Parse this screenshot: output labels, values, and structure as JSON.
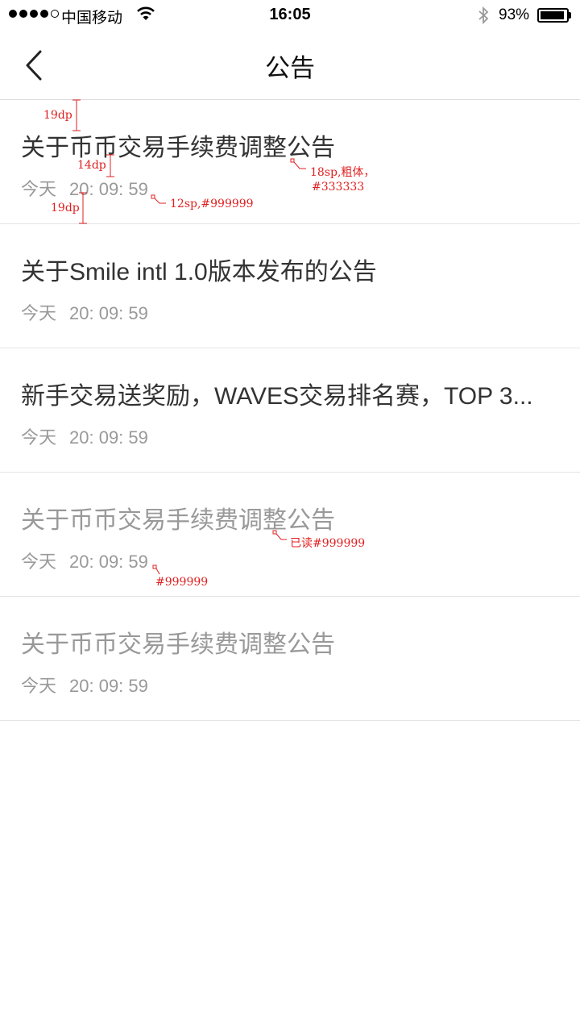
{
  "status_bar": {
    "carrier": "中国移动",
    "time": "16:05",
    "battery_percent": "93%",
    "battery_level": 0.93,
    "signal_bars_filled": 4,
    "signal_bars_total": 5
  },
  "nav": {
    "title": "公告",
    "back_icon": "chevron-left-icon"
  },
  "announcements": [
    {
      "title": "关于币币交易手续费调整公告",
      "day": "今天",
      "time": "20: 09: 59",
      "read": false
    },
    {
      "title": "关于Smile intl 1.0版本发布的公告",
      "day": "今天",
      "time": "20: 09: 59",
      "read": false
    },
    {
      "title": "新手交易送奖励，WAVES交易排名赛，TOP 3...",
      "day": "今天",
      "time": "20: 09: 59",
      "read": false
    },
    {
      "title": "关于币币交易手续费调整公告",
      "day": "今天",
      "time": "20: 09: 59",
      "read": true
    },
    {
      "title": "关于币币交易手续费调整公告",
      "day": "今天",
      "time": "20: 09: 59",
      "read": true
    }
  ],
  "annotations": {
    "top_spacing": "19dp",
    "title_meta_spacing": "14dp",
    "bottom_spacing": "19dp",
    "title_style": "18sp,粗体，",
    "title_color": "#333333",
    "meta_style": "12sp,#999999",
    "read_title_style": "已读#999999",
    "read_meta_color": "#999999"
  },
  "colors": {
    "title_unread": "#333333",
    "text_secondary": "#999999",
    "divider": "#e4e4e4",
    "annotation": "#e02020"
  }
}
